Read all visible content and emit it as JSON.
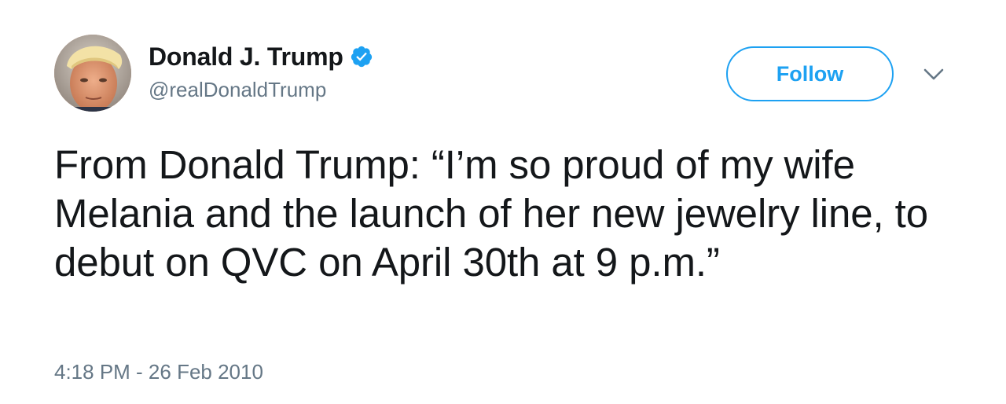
{
  "tweet": {
    "author": {
      "display_name": "Donald J. Trump",
      "handle": "@realDonaldTrump",
      "verified": true,
      "avatar_icon": "profile-photo"
    },
    "follow_label": "Follow",
    "menu_icon": "chevron-down-icon",
    "text": "From Donald Trump: “I’m so proud of my wife Melania and the launch of her new jewelry line, to debut on QVC on April 30th at 9 p.m.”",
    "timestamp": "4:18 PM - 26 Feb 2010"
  },
  "colors": {
    "accent": "#1da1f2",
    "text_primary": "#14171a",
    "text_secondary": "#657786",
    "background": "#ffffff"
  }
}
